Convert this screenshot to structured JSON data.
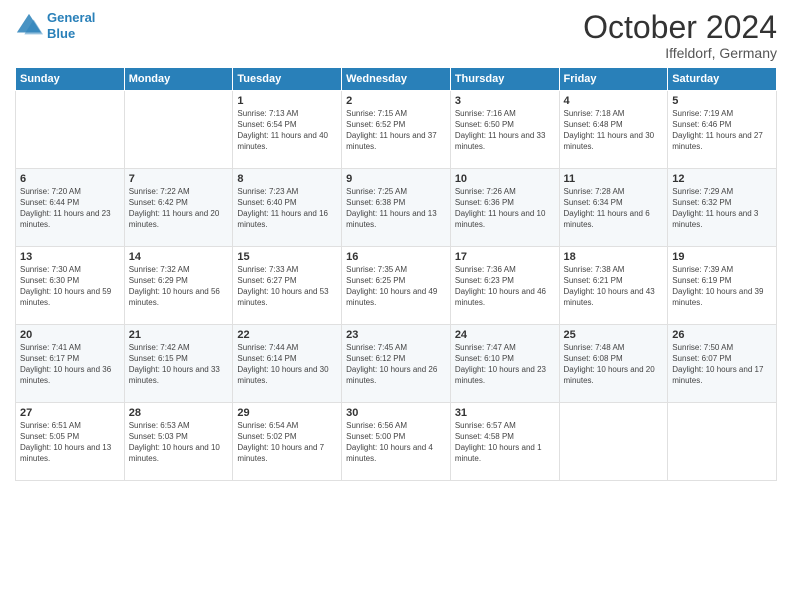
{
  "header": {
    "logo_line1": "General",
    "logo_line2": "Blue",
    "month": "October 2024",
    "location": "Iffeldorf, Germany"
  },
  "days_of_week": [
    "Sunday",
    "Monday",
    "Tuesday",
    "Wednesday",
    "Thursday",
    "Friday",
    "Saturday"
  ],
  "weeks": [
    [
      {
        "day": "",
        "content": ""
      },
      {
        "day": "",
        "content": ""
      },
      {
        "day": "1",
        "content": "Sunrise: 7:13 AM\nSunset: 6:54 PM\nDaylight: 11 hours and 40 minutes."
      },
      {
        "day": "2",
        "content": "Sunrise: 7:15 AM\nSunset: 6:52 PM\nDaylight: 11 hours and 37 minutes."
      },
      {
        "day": "3",
        "content": "Sunrise: 7:16 AM\nSunset: 6:50 PM\nDaylight: 11 hours and 33 minutes."
      },
      {
        "day": "4",
        "content": "Sunrise: 7:18 AM\nSunset: 6:48 PM\nDaylight: 11 hours and 30 minutes."
      },
      {
        "day": "5",
        "content": "Sunrise: 7:19 AM\nSunset: 6:46 PM\nDaylight: 11 hours and 27 minutes."
      }
    ],
    [
      {
        "day": "6",
        "content": "Sunrise: 7:20 AM\nSunset: 6:44 PM\nDaylight: 11 hours and 23 minutes."
      },
      {
        "day": "7",
        "content": "Sunrise: 7:22 AM\nSunset: 6:42 PM\nDaylight: 11 hours and 20 minutes."
      },
      {
        "day": "8",
        "content": "Sunrise: 7:23 AM\nSunset: 6:40 PM\nDaylight: 11 hours and 16 minutes."
      },
      {
        "day": "9",
        "content": "Sunrise: 7:25 AM\nSunset: 6:38 PM\nDaylight: 11 hours and 13 minutes."
      },
      {
        "day": "10",
        "content": "Sunrise: 7:26 AM\nSunset: 6:36 PM\nDaylight: 11 hours and 10 minutes."
      },
      {
        "day": "11",
        "content": "Sunrise: 7:28 AM\nSunset: 6:34 PM\nDaylight: 11 hours and 6 minutes."
      },
      {
        "day": "12",
        "content": "Sunrise: 7:29 AM\nSunset: 6:32 PM\nDaylight: 11 hours and 3 minutes."
      }
    ],
    [
      {
        "day": "13",
        "content": "Sunrise: 7:30 AM\nSunset: 6:30 PM\nDaylight: 10 hours and 59 minutes."
      },
      {
        "day": "14",
        "content": "Sunrise: 7:32 AM\nSunset: 6:29 PM\nDaylight: 10 hours and 56 minutes."
      },
      {
        "day": "15",
        "content": "Sunrise: 7:33 AM\nSunset: 6:27 PM\nDaylight: 10 hours and 53 minutes."
      },
      {
        "day": "16",
        "content": "Sunrise: 7:35 AM\nSunset: 6:25 PM\nDaylight: 10 hours and 49 minutes."
      },
      {
        "day": "17",
        "content": "Sunrise: 7:36 AM\nSunset: 6:23 PM\nDaylight: 10 hours and 46 minutes."
      },
      {
        "day": "18",
        "content": "Sunrise: 7:38 AM\nSunset: 6:21 PM\nDaylight: 10 hours and 43 minutes."
      },
      {
        "day": "19",
        "content": "Sunrise: 7:39 AM\nSunset: 6:19 PM\nDaylight: 10 hours and 39 minutes."
      }
    ],
    [
      {
        "day": "20",
        "content": "Sunrise: 7:41 AM\nSunset: 6:17 PM\nDaylight: 10 hours and 36 minutes."
      },
      {
        "day": "21",
        "content": "Sunrise: 7:42 AM\nSunset: 6:15 PM\nDaylight: 10 hours and 33 minutes."
      },
      {
        "day": "22",
        "content": "Sunrise: 7:44 AM\nSunset: 6:14 PM\nDaylight: 10 hours and 30 minutes."
      },
      {
        "day": "23",
        "content": "Sunrise: 7:45 AM\nSunset: 6:12 PM\nDaylight: 10 hours and 26 minutes."
      },
      {
        "day": "24",
        "content": "Sunrise: 7:47 AM\nSunset: 6:10 PM\nDaylight: 10 hours and 23 minutes."
      },
      {
        "day": "25",
        "content": "Sunrise: 7:48 AM\nSunset: 6:08 PM\nDaylight: 10 hours and 20 minutes."
      },
      {
        "day": "26",
        "content": "Sunrise: 7:50 AM\nSunset: 6:07 PM\nDaylight: 10 hours and 17 minutes."
      }
    ],
    [
      {
        "day": "27",
        "content": "Sunrise: 6:51 AM\nSunset: 5:05 PM\nDaylight: 10 hours and 13 minutes."
      },
      {
        "day": "28",
        "content": "Sunrise: 6:53 AM\nSunset: 5:03 PM\nDaylight: 10 hours and 10 minutes."
      },
      {
        "day": "29",
        "content": "Sunrise: 6:54 AM\nSunset: 5:02 PM\nDaylight: 10 hours and 7 minutes."
      },
      {
        "day": "30",
        "content": "Sunrise: 6:56 AM\nSunset: 5:00 PM\nDaylight: 10 hours and 4 minutes."
      },
      {
        "day": "31",
        "content": "Sunrise: 6:57 AM\nSunset: 4:58 PM\nDaylight: 10 hours and 1 minute."
      },
      {
        "day": "",
        "content": ""
      },
      {
        "day": "",
        "content": ""
      }
    ]
  ]
}
